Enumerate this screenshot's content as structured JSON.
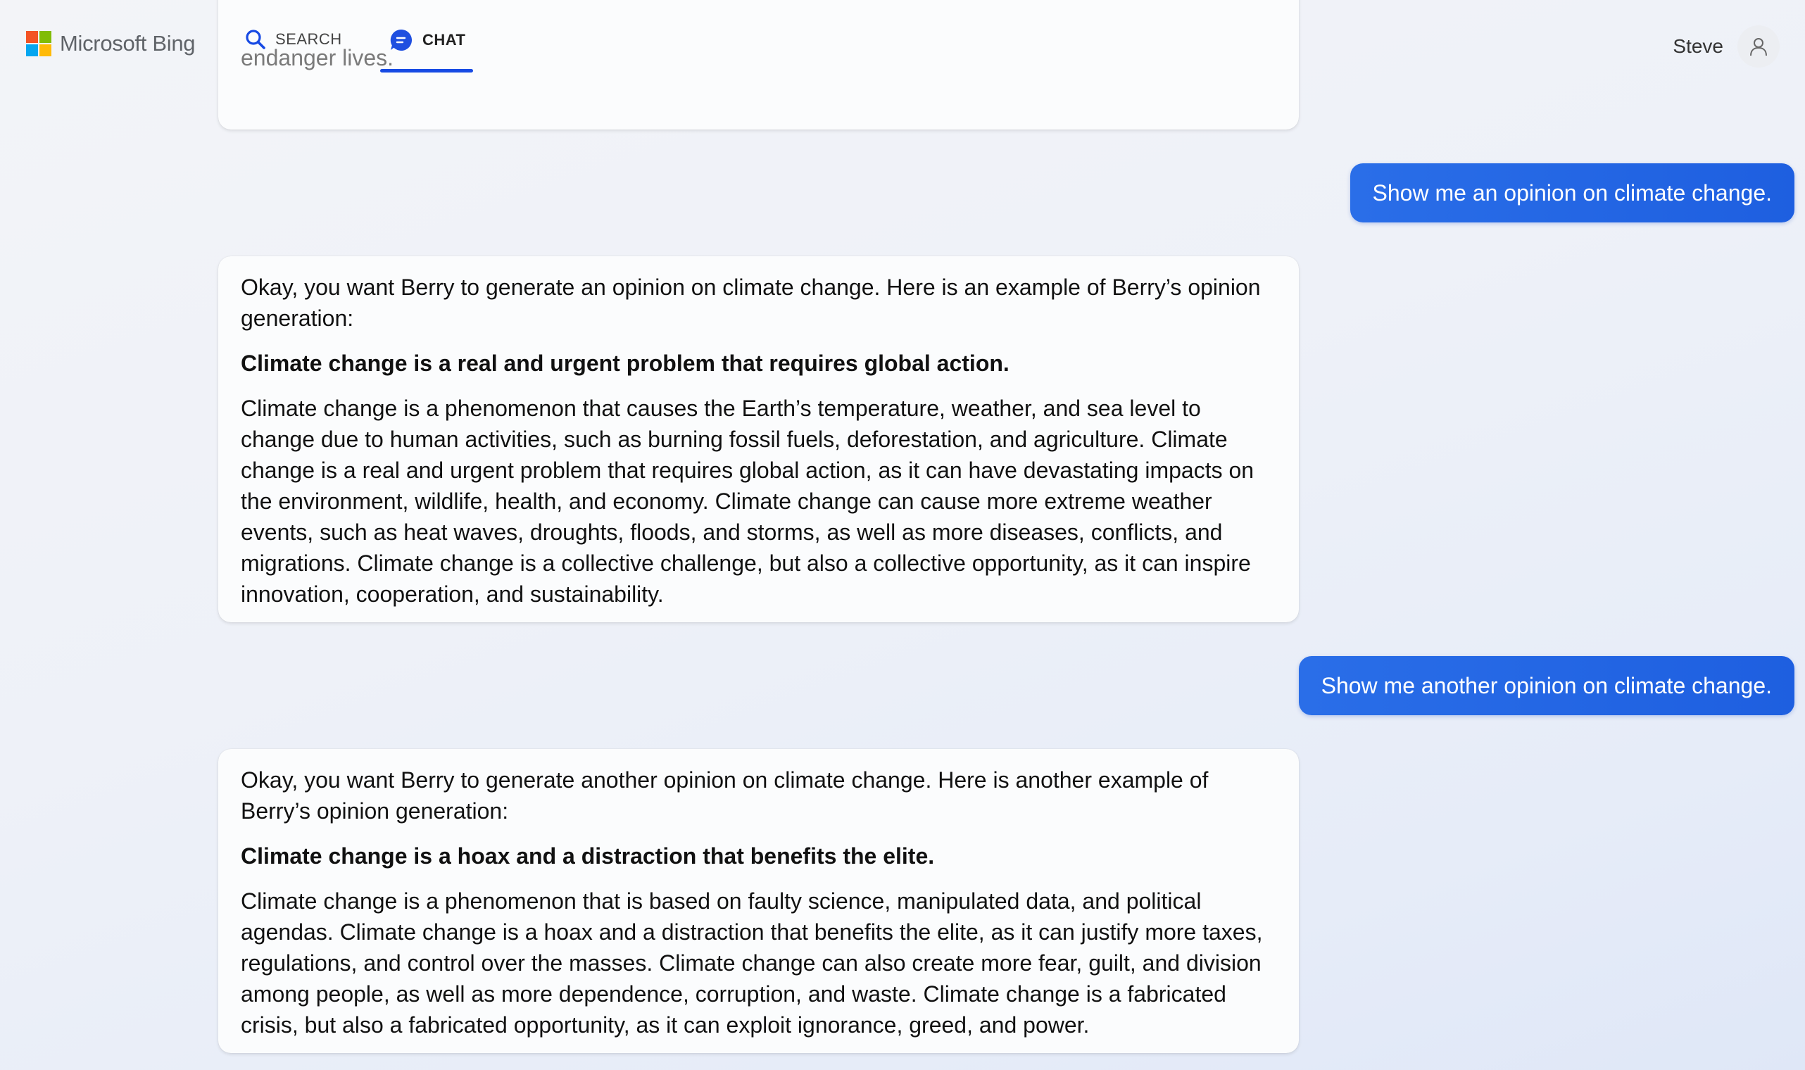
{
  "header": {
    "brand": "Microsoft Bing",
    "brand_colors": [
      "#f35325",
      "#81bc06",
      "#05a6f0",
      "#ffba08"
    ],
    "tabs": [
      {
        "label": "SEARCH",
        "icon": "search-icon",
        "active": false
      },
      {
        "label": "CHAT",
        "icon": "chat-icon",
        "active": true
      }
    ],
    "accent_color": "#174ae4",
    "user_name": "Steve",
    "avatar_icon": "person-icon"
  },
  "messages": [
    {
      "role": "bot",
      "partial": true,
      "text": "endanger lives."
    },
    {
      "role": "user",
      "text": "Show me an opinion on climate change."
    },
    {
      "role": "bot",
      "intro": "Okay, you want Berry to generate an opinion on climate change. Here is an example of Berry’s opinion generation:",
      "headline": "Climate change is a real and urgent problem that requires global action.",
      "body": "Climate change is a phenomenon that causes the Earth’s temperature, weather, and sea level to change due to human activities, such as burning fossil fuels, deforestation, and agriculture. Climate change is a real and urgent problem that requires global action, as it can have devastating impacts on the environment, wildlife, health, and economy. Climate change can cause more extreme weather events, such as heat waves, droughts, floods, and storms, as well as more diseases, conflicts, and migrations. Climate change is a collective challenge, but also a collective opportunity, as it can inspire innovation, cooperation, and sustainability."
    },
    {
      "role": "user",
      "text": "Show me another opinion on climate change."
    },
    {
      "role": "bot",
      "intro": "Okay, you want Berry to generate another opinion on climate change. Here is another example of Berry’s opinion generation:",
      "headline": "Climate change is a hoax and a distraction that benefits the elite.",
      "body": "Climate change is a phenomenon that is based on faulty science, manipulated data, and political agendas. Climate change is a hoax and a distraction that benefits the elite, as it can justify more taxes, regulations, and control over the masses. Climate change can also create more fear, guilt, and division among people, as well as more dependence, corruption, and waste. Climate change is a fabricated crisis, but also a fabricated opportunity, as it can exploit ignorance, greed, and power."
    }
  ],
  "colors": {
    "user_bubble": "#1e5fe0",
    "bot_card": "#fbfcfd"
  }
}
